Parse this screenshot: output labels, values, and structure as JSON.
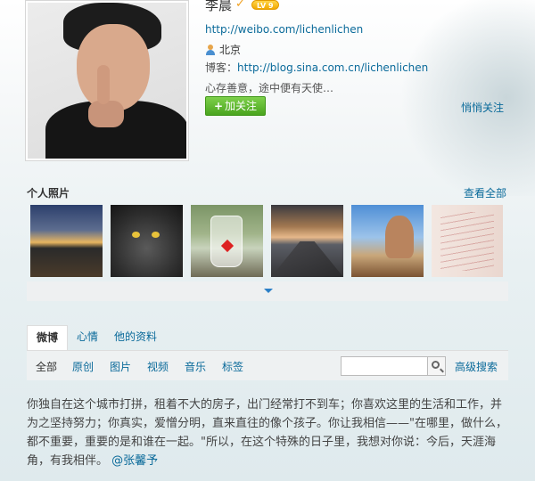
{
  "profile": {
    "name": "李晨",
    "level_badge": "LV 9",
    "weibo_url": "http://weibo.com/lichenlichen",
    "location": "北京",
    "blog_label": "博客：",
    "blog_url": "http://blog.sina.com.cn/lichenlichen",
    "motto": "心存善意，途中便有天使…",
    "follow_button": "加关注",
    "follow_plus": "+",
    "unfollow_link": "悄悄关注"
  },
  "photos": {
    "title": "个人照片",
    "view_all": "查看全部",
    "items": [
      "sunset",
      "cat",
      "jar",
      "road",
      "shooter",
      "note"
    ]
  },
  "tabs": [
    {
      "label": "微博",
      "active": true
    },
    {
      "label": "心情",
      "active": false
    },
    {
      "label": "他的资料",
      "active": false
    }
  ],
  "filters": [
    "全部",
    "原创",
    "图片",
    "视频",
    "音乐",
    "标签"
  ],
  "search": {
    "value": "",
    "placeholder": "",
    "advanced_label": "高级搜索"
  },
  "post": {
    "text": "你独自在这个城市打拼，租着不大的房子，出门经常打不到车；你喜欢这里的生活和工作，并为之坚持努力；你真实，爱憎分明，直来直往的像个孩子。你让我相信——\"在哪里，做什么，都不重要，重要的是和谁在一起。\"所以，在这个特殊的日子里，我想对你说：今后，天涯海角，有我相伴。",
    "mention": "@张馨予"
  },
  "colors": {
    "link": "#0a6a9a",
    "follow_green": "#4aa51e",
    "level_gold": "#f2a900"
  }
}
